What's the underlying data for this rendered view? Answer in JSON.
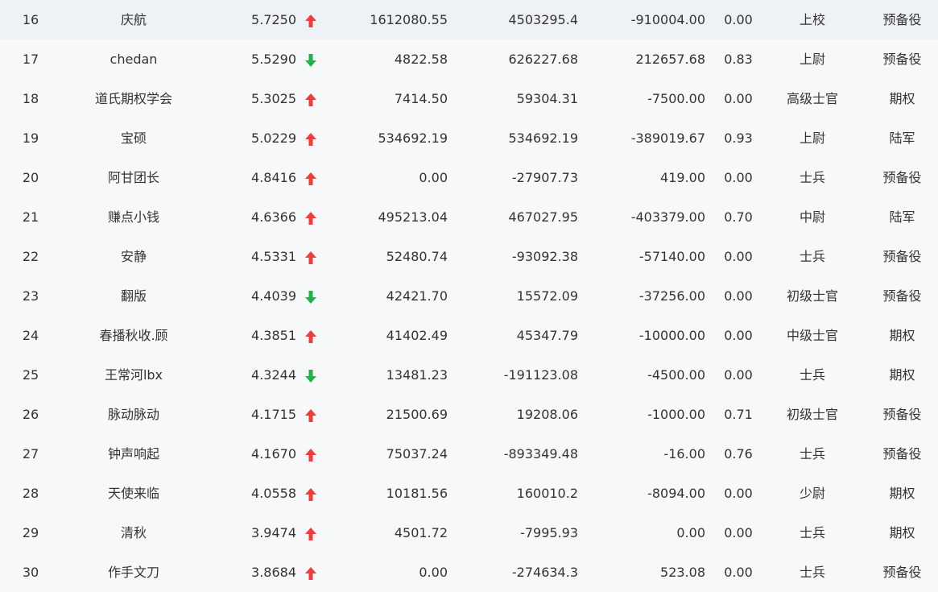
{
  "colors": {
    "up": "#f23c3c",
    "down": "#21b24b",
    "text": "#333333",
    "background": "#f7f8fa"
  },
  "rows": [
    {
      "rank": "16",
      "name": "庆航",
      "score": "5.7250",
      "trend": "up",
      "v1": "1612080.55",
      "v2": "4503295.4",
      "v3": "-910004.00",
      "ratio": "0.00",
      "title": "上校",
      "type": "预备役"
    },
    {
      "rank": "17",
      "name": "chedan",
      "score": "5.5290",
      "trend": "down",
      "v1": "4822.58",
      "v2": "626227.68",
      "v3": "212657.68",
      "ratio": "0.83",
      "title": "上尉",
      "type": "预备役"
    },
    {
      "rank": "18",
      "name": "道氏期权学会",
      "score": "5.3025",
      "trend": "up",
      "v1": "7414.50",
      "v2": "59304.31",
      "v3": "-7500.00",
      "ratio": "0.00",
      "title": "高级士官",
      "type": "期权"
    },
    {
      "rank": "19",
      "name": "宝硕",
      "score": "5.0229",
      "trend": "up",
      "v1": "534692.19",
      "v2": "534692.19",
      "v3": "-389019.67",
      "ratio": "0.93",
      "title": "上尉",
      "type": "陆军"
    },
    {
      "rank": "20",
      "name": "阿甘团长",
      "score": "4.8416",
      "trend": "up",
      "v1": "0.00",
      "v2": "-27907.73",
      "v3": "419.00",
      "ratio": "0.00",
      "title": "士兵",
      "type": "预备役"
    },
    {
      "rank": "21",
      "name": "赚点小钱",
      "score": "4.6366",
      "trend": "up",
      "v1": "495213.04",
      "v2": "467027.95",
      "v3": "-403379.00",
      "ratio": "0.70",
      "title": "中尉",
      "type": "陆军"
    },
    {
      "rank": "22",
      "name": "安静",
      "score": "4.5331",
      "trend": "up",
      "v1": "52480.74",
      "v2": "-93092.38",
      "v3": "-57140.00",
      "ratio": "0.00",
      "title": "士兵",
      "type": "预备役"
    },
    {
      "rank": "23",
      "name": "翻版",
      "score": "4.4039",
      "trend": "down",
      "v1": "42421.70",
      "v2": "15572.09",
      "v3": "-37256.00",
      "ratio": "0.00",
      "title": "初级士官",
      "type": "预备役"
    },
    {
      "rank": "24",
      "name": "春播秋收.顾",
      "score": "4.3851",
      "trend": "up",
      "v1": "41402.49",
      "v2": "45347.79",
      "v3": "-10000.00",
      "ratio": "0.00",
      "title": "中级士官",
      "type": "期权"
    },
    {
      "rank": "25",
      "name": "王常河lbx",
      "score": "4.3244",
      "trend": "down",
      "v1": "13481.23",
      "v2": "-191123.08",
      "v3": "-4500.00",
      "ratio": "0.00",
      "title": "士兵",
      "type": "期权"
    },
    {
      "rank": "26",
      "name": "脉动脉动",
      "score": "4.1715",
      "trend": "up",
      "v1": "21500.69",
      "v2": "19208.06",
      "v3": "-1000.00",
      "ratio": "0.71",
      "title": "初级士官",
      "type": "预备役"
    },
    {
      "rank": "27",
      "name": "钟声响起",
      "score": "4.1670",
      "trend": "up",
      "v1": "75037.24",
      "v2": "-893349.48",
      "v3": "-16.00",
      "ratio": "0.76",
      "title": "士兵",
      "type": "预备役"
    },
    {
      "rank": "28",
      "name": "天使来临",
      "score": "4.0558",
      "trend": "up",
      "v1": "10181.56",
      "v2": "160010.2",
      "v3": "-8094.00",
      "ratio": "0.00",
      "title": "少尉",
      "type": "期权"
    },
    {
      "rank": "29",
      "name": "清秋",
      "score": "3.9474",
      "trend": "up",
      "v1": "4501.72",
      "v2": "-7995.93",
      "v3": "0.00",
      "ratio": "0.00",
      "title": "士兵",
      "type": "期权"
    },
    {
      "rank": "30",
      "name": "作手文刀",
      "score": "3.8684",
      "trend": "up",
      "v1": "0.00",
      "v2": "-274634.3",
      "v3": "523.08",
      "ratio": "0.00",
      "title": "士兵",
      "type": "预备役"
    }
  ]
}
